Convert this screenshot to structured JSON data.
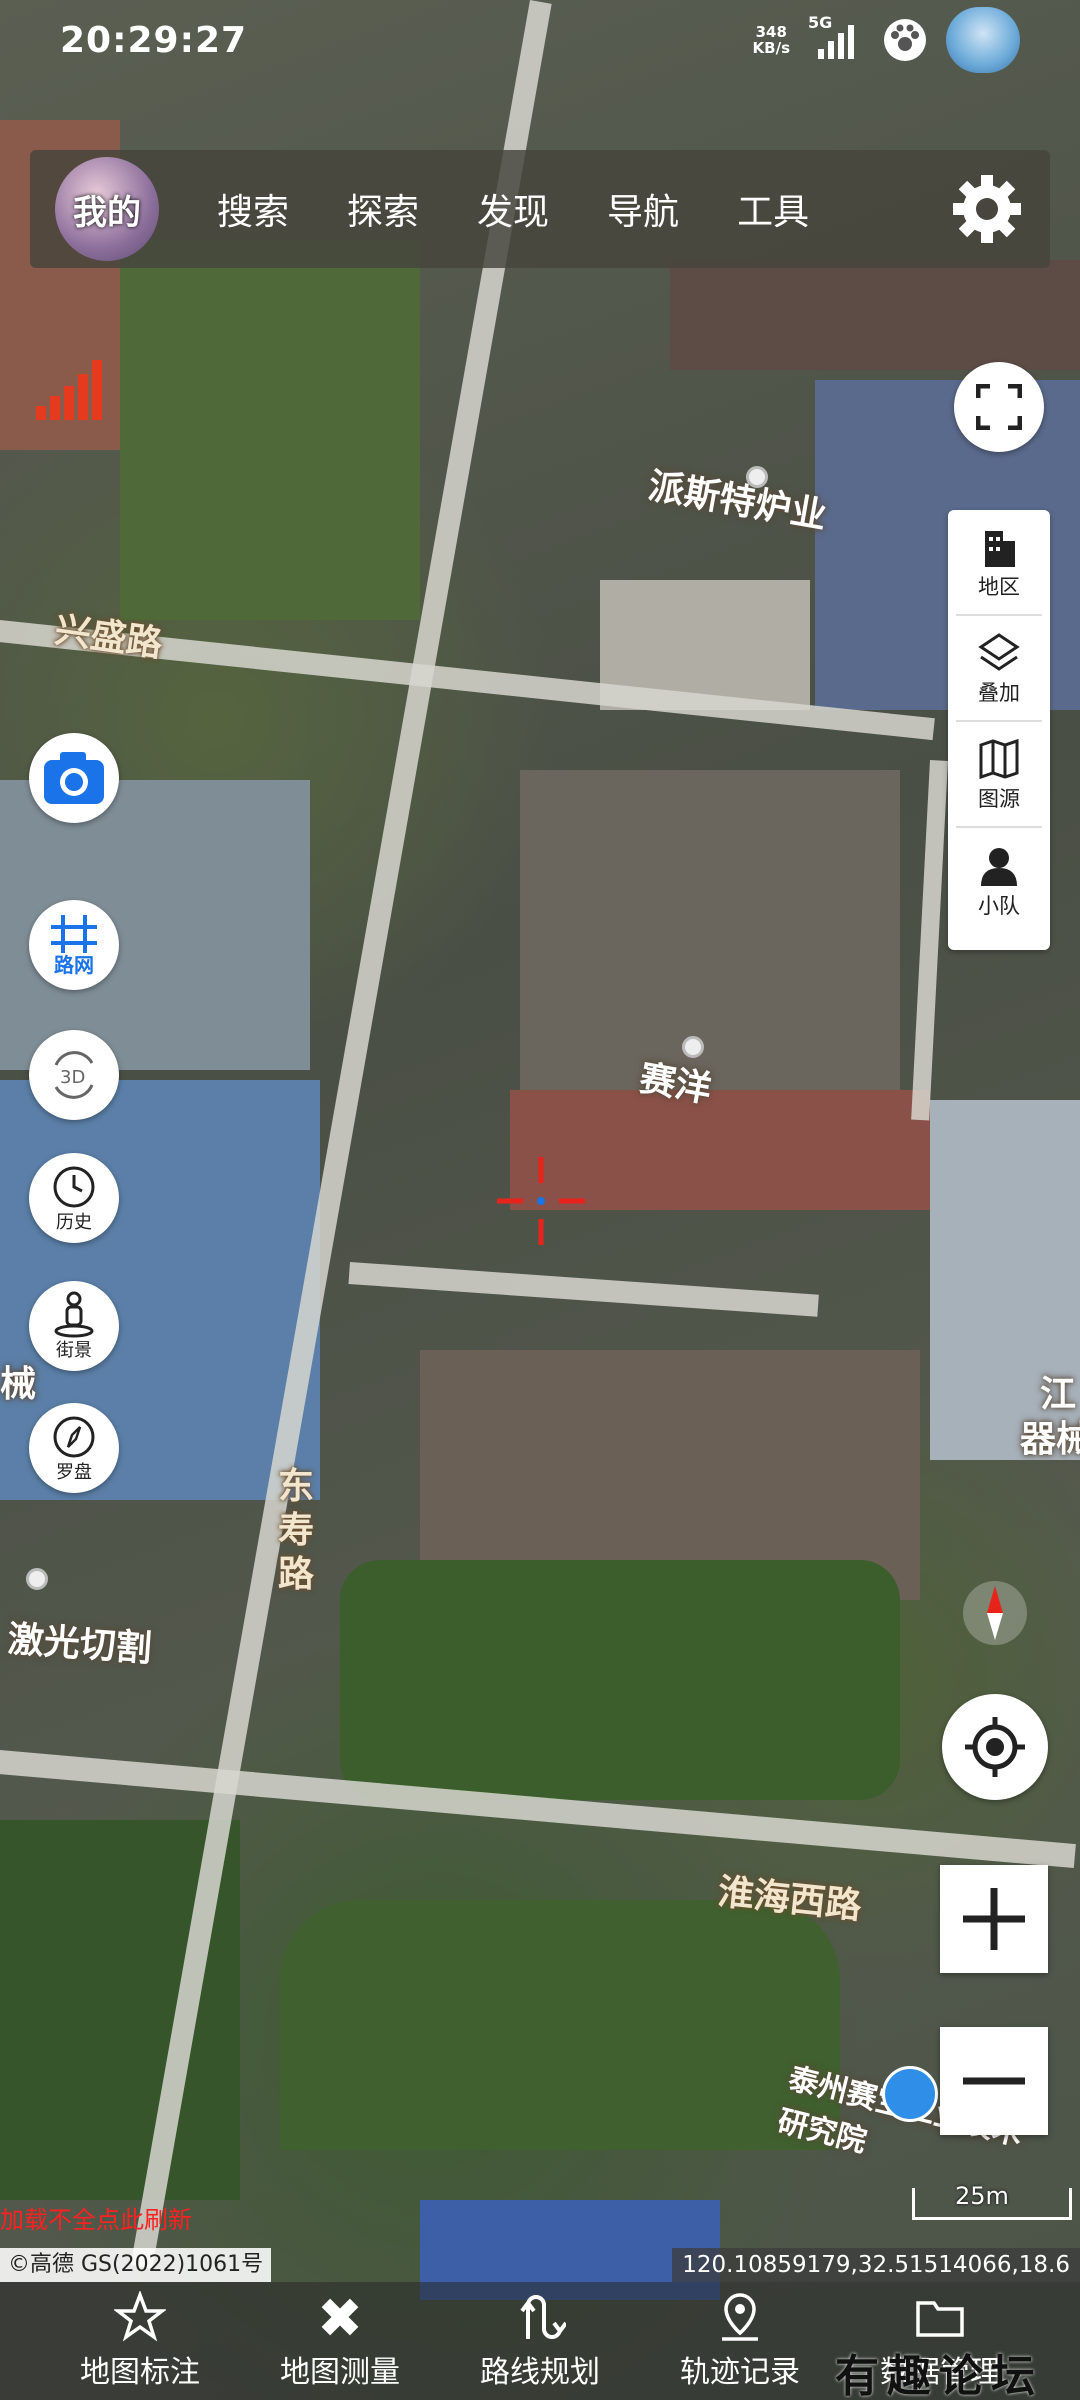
{
  "status_bar": {
    "time": "20:29:27",
    "net_speed_value": "348",
    "net_speed_unit": "KB/s",
    "network": "5G"
  },
  "top_menu": {
    "avatar_label": "我的",
    "items": [
      "搜索",
      "探索",
      "发现",
      "导航",
      "工具"
    ]
  },
  "left_buttons": {
    "roadnet_label": "路网",
    "history_label": "历史",
    "streetview_label": "街景",
    "compass_label": "罗盘"
  },
  "right_panel": {
    "items": [
      "地区",
      "叠加",
      "图源",
      "小队"
    ]
  },
  "map_labels": {
    "road_1": "兴盛路",
    "road_2": "东寿路",
    "road_3": "淮海西路",
    "poi_1": "派斯特炉业",
    "poi_2": "赛洋",
    "poi_3": "激光切割",
    "poi_4": "泰州赛宝工业技术研究院",
    "poi_5": "江",
    "poi_6": "器械",
    "poi_7": "械"
  },
  "load_tip": "加载不全点此刷新",
  "copyright": "©高德 GS(2022)1061号",
  "coordinates": "120.10859179,32.51514066,18.6",
  "scale_label": "25m",
  "bottom_nav": {
    "items": [
      "地图标注",
      "地图测量",
      "路线规划",
      "轨迹记录",
      "数据管理"
    ]
  },
  "watermark": "有趣论坛",
  "colors": {
    "accent_blue": "#1a73e8",
    "signal_red": "#e63a1f",
    "crosshair_red": "#e8231c",
    "tip_red": "#ff2020"
  }
}
